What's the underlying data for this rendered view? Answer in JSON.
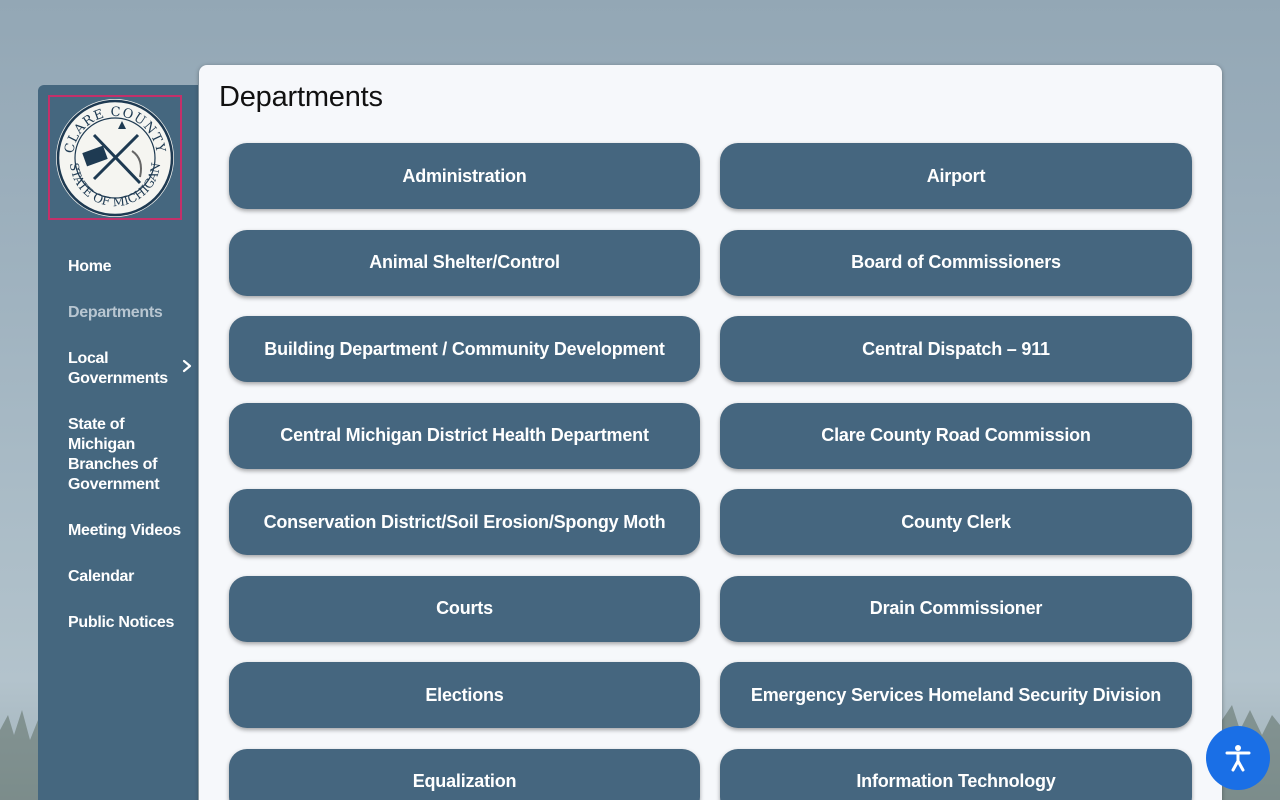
{
  "sidebar": {
    "logo": {
      "top_text": "CLARE COUNTY",
      "bottom_text": "STATE OF MICHIGAN"
    },
    "nav": [
      {
        "label": "Home",
        "active": false
      },
      {
        "label": "Departments",
        "active": true
      },
      {
        "label": "Local Governments",
        "active": false,
        "has_submenu": true
      },
      {
        "label": "State of Michigan Branches of Government",
        "active": false
      },
      {
        "label": "Meeting Videos",
        "active": false
      },
      {
        "label": "Calendar",
        "active": false
      },
      {
        "label": "Public Notices",
        "active": false
      }
    ]
  },
  "main": {
    "title": "Departments",
    "departments": [
      "Administration",
      "Airport",
      "Animal Shelter/Control",
      "Board of Commissioners",
      "Building Department / Community Development",
      "Central Dispatch – 911",
      "Central Michigan District Health Department",
      "Clare County Road Commission",
      "Conservation District/Soil Erosion/Spongy Moth",
      "County Clerk",
      "Courts",
      "Drain Commissioner",
      "Elections",
      "Emergency Services Homeland Security Division",
      "Equalization",
      "Information Technology"
    ]
  },
  "accessibility_button": {
    "icon": "accessibility-icon"
  },
  "colors": {
    "sidebar_bg": "#45677f",
    "button_bg": "#45667f",
    "panel_bg": "#f6f8fb",
    "logo_border": "#c3306a",
    "active_nav": "#b8c6d1",
    "a11y_bg": "#1a6fe6"
  }
}
